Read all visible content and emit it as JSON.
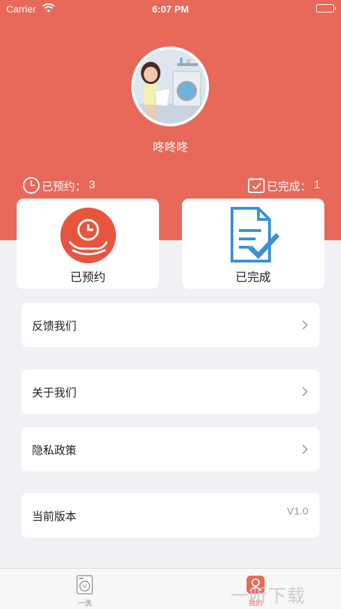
{
  "status_bar": {
    "carrier": "Carrier",
    "time": "6:07 PM"
  },
  "profile": {
    "username": "咚咚咚"
  },
  "stats": {
    "booked_label": "已预约：",
    "booked_count": "3",
    "completed_label": "已完成：",
    "completed_count": "1"
  },
  "cards": {
    "booked": "已预约",
    "completed": "已完成"
  },
  "menu": {
    "feedback": "反馈我们",
    "about": "关于我们",
    "privacy": "隐私政策",
    "version_label": "当前版本",
    "version_value": "V1.0"
  },
  "tabs": {
    "wash": "一洗",
    "mine": "我的"
  },
  "watermark": "一听下载",
  "colors": {
    "accent": "#e8695a",
    "blue": "#3a8fd8",
    "background": "#f1f1f5"
  }
}
